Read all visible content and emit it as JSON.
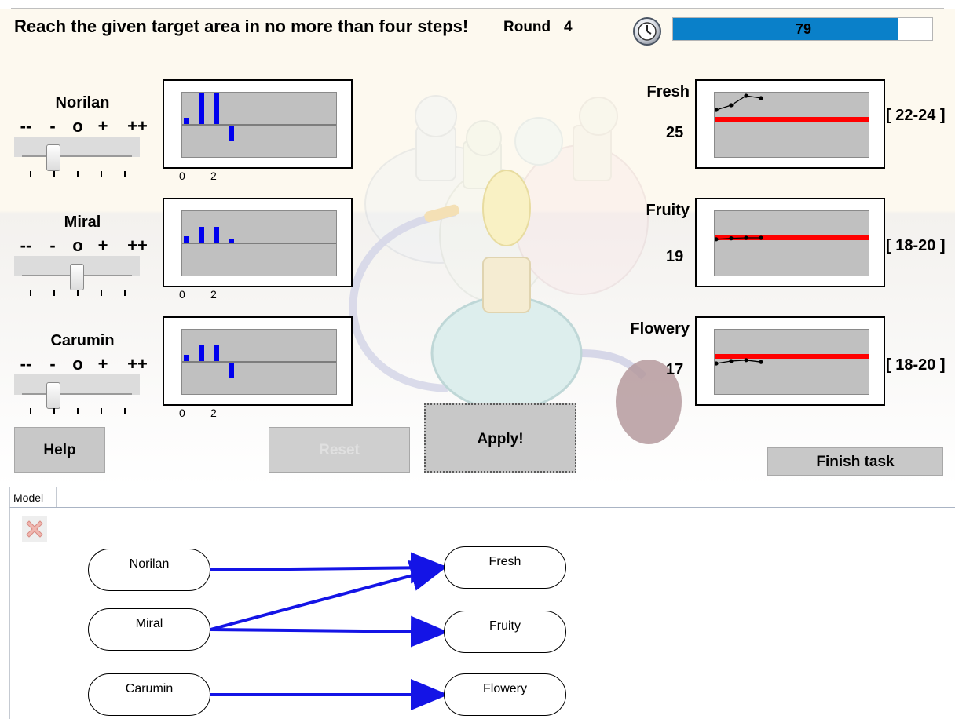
{
  "instruction": "Reach the given target area in no more than four steps!",
  "round": {
    "label": "Round",
    "value": "4"
  },
  "timer": {
    "value": "79",
    "fraction": 0.87
  },
  "scale_labels": [
    "--",
    "-",
    "o",
    "+",
    "++"
  ],
  "axis_ticks": [
    "0",
    "2"
  ],
  "inputs": [
    {
      "name": "Norilan",
      "slider_level": "-",
      "history": [
        0.2,
        1,
        1,
        -0.5
      ]
    },
    {
      "name": "Miral",
      "slider_level": "o",
      "history": [
        0.2,
        0.5,
        0.5,
        0.1
      ]
    },
    {
      "name": "Carumin",
      "slider_level": "-",
      "history": [
        0.2,
        0.5,
        0.5,
        -0.5
      ]
    }
  ],
  "outputs": [
    {
      "name": "Fresh",
      "value": "25",
      "range": "[ 22-24 ]",
      "target_min": 22,
      "target_max": 24,
      "history": [
        25,
        26,
        28,
        27.5
      ]
    },
    {
      "name": "Fruity",
      "value": "19",
      "range": "[ 18-20 ]",
      "target_min": 18,
      "target_max": 20,
      "history": [
        18.7,
        18.9,
        19,
        19
      ]
    },
    {
      "name": "Flowery",
      "value": "17",
      "range": "[ 18-20 ]",
      "target_min": 18,
      "target_max": 20,
      "history": [
        17.5,
        18,
        18.2,
        17.8
      ]
    }
  ],
  "buttons": {
    "help": "Help",
    "reset": "Reset",
    "apply": "Apply!",
    "finish": "Finish task"
  },
  "model": {
    "tab_label": "Model",
    "inputs": [
      "Norilan",
      "Miral",
      "Carumin"
    ],
    "outputs": [
      "Fresh",
      "Fruity",
      "Flowery"
    ],
    "edges": [
      [
        "Norilan",
        "Fresh"
      ],
      [
        "Miral",
        "Fresh"
      ],
      [
        "Miral",
        "Fruity"
      ],
      [
        "Carumin",
        "Flowery"
      ]
    ]
  }
}
